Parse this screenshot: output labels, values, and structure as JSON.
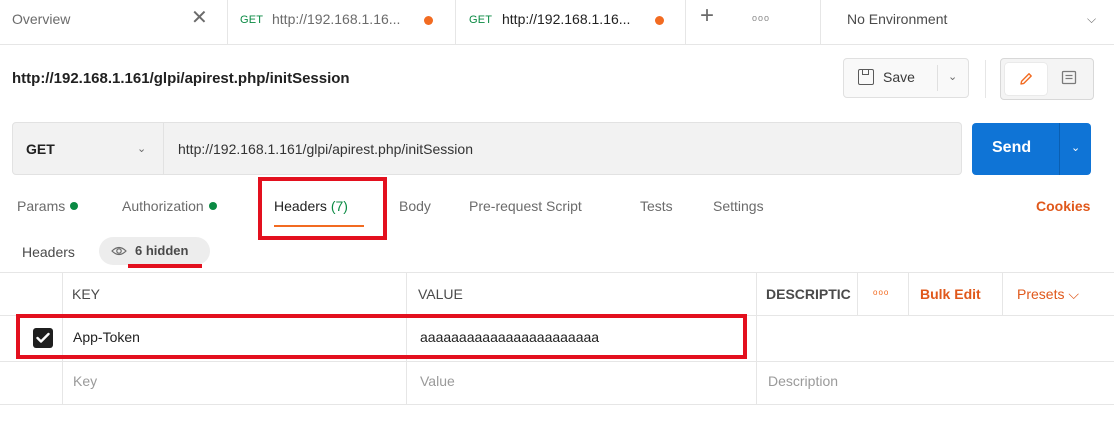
{
  "tabs": {
    "overview": {
      "label": "Overview",
      "close": "✕"
    },
    "request1": {
      "method": "GET",
      "url": "http://192.168.1.16..."
    },
    "request2": {
      "method": "GET",
      "url": "http://192.168.1.16..."
    },
    "new_tab": "+",
    "more": "ooo"
  },
  "environment": {
    "label": "No Environment",
    "chevron": "⌵"
  },
  "request": {
    "title": "http://192.168.1.161/glpi/apirest.php/initSession",
    "save_label": "Save",
    "method": "GET",
    "url": "http://192.168.1.161/glpi/apirest.php/initSession",
    "send_label": "Send"
  },
  "subtabs": {
    "params": "Params",
    "authorization": "Authorization",
    "headers": "Headers",
    "headers_count": "(7)",
    "body": "Body",
    "pre_request": "Pre-request Script",
    "tests": "Tests",
    "settings": "Settings",
    "cookies": "Cookies"
  },
  "headers_section": {
    "label": "Headers",
    "hidden_text": "6 hidden"
  },
  "table": {
    "col_key": "KEY",
    "col_value": "VALUE",
    "col_description": "DESCRIPTIC",
    "more": "ooo",
    "bulk_edit": "Bulk Edit",
    "presets": "Presets ⌵",
    "rows": [
      {
        "checked": true,
        "key": "App-Token",
        "value": "aaaaaaaaaaaaaaaaaaaaaaa"
      }
    ],
    "placeholders": {
      "key": "Key",
      "value": "Value",
      "description": "Description"
    }
  },
  "colors": {
    "accent": "#f26b21",
    "send": "#0f74d6",
    "get": "#0a8a43",
    "annotation": "#e3101e"
  }
}
